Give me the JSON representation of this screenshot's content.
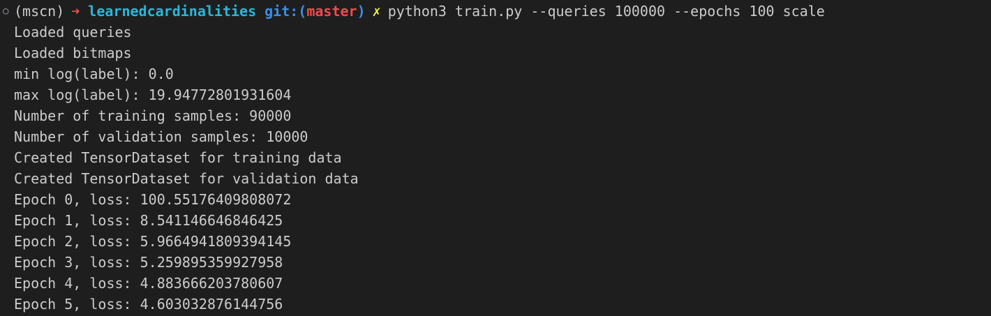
{
  "prompt": {
    "status_icon": "○",
    "venv": "(mscn)",
    "arrow": "➜",
    "directory": "learnedcardinalities",
    "git_label_open": "git:(",
    "branch": "master",
    "git_label_close": ")",
    "dirty_marker": "✗",
    "command": "python3 train.py --queries 100000 --epochs 100 scale"
  },
  "output_lines": [
    "Loaded queries",
    "Loaded bitmaps",
    "min log(label): 0.0",
    "max log(label): 19.94772801931604",
    "Number of training samples: 90000",
    "Number of validation samples: 10000",
    "Created TensorDataset for training data",
    "Created TensorDataset for validation data",
    "Epoch 0, loss: 100.55176409808072",
    "Epoch 1, loss: 8.541146646846425",
    "Epoch 2, loss: 5.9664941809394145",
    "Epoch 3, loss: 5.259895359927958",
    "Epoch 4, loss: 4.883666203780607",
    "Epoch 5, loss: 4.603032876144756"
  ],
  "colors": {
    "background": "#1e1e1e",
    "text": "#cccccc",
    "arrow": "#f14c4c",
    "directory": "#29b8db",
    "git": "#3b8eea",
    "branch": "#f14c4c",
    "dirty": "#f5f543"
  }
}
